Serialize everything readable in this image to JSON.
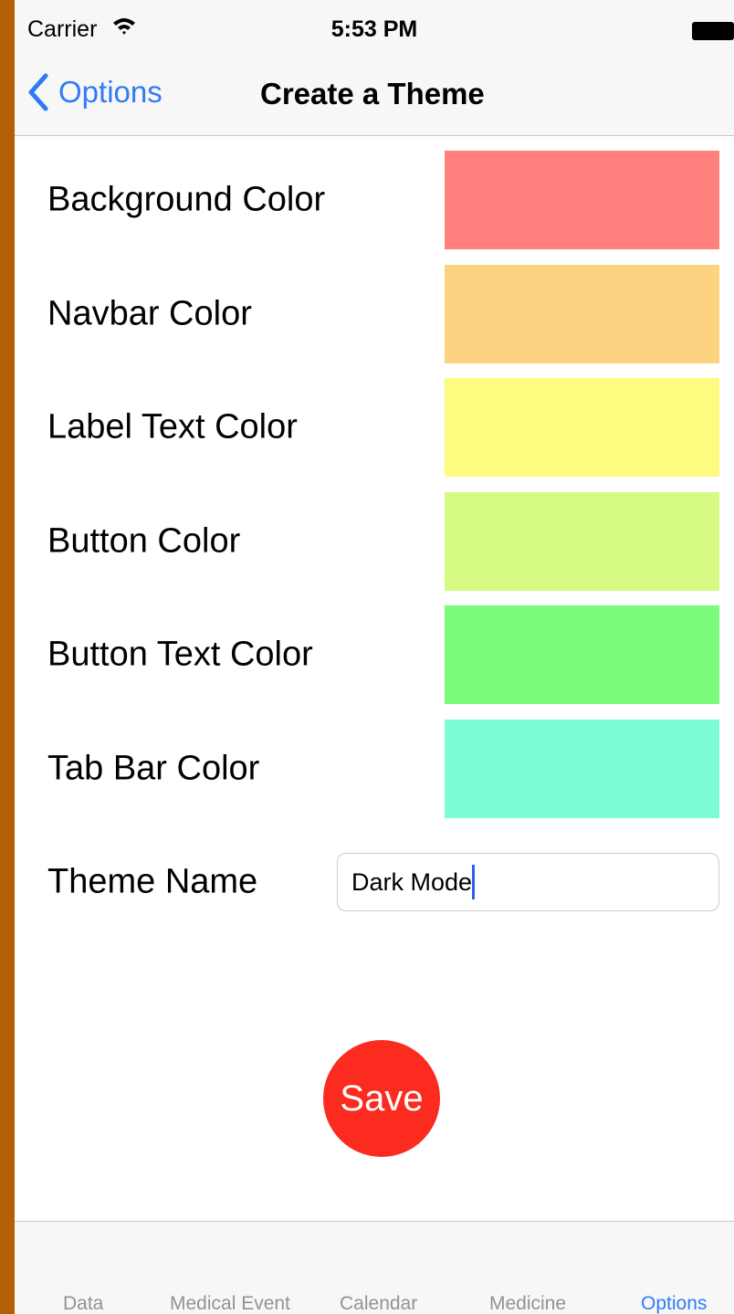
{
  "status_bar": {
    "carrier": "Carrier",
    "time": "5:53 PM"
  },
  "nav": {
    "back_label": "Options",
    "title": "Create a Theme"
  },
  "color_rows": [
    {
      "label": "Background Color",
      "color": "#ff807d"
    },
    {
      "label": "Navbar Color",
      "color": "#fcd381"
    },
    {
      "label": "Label Text Color",
      "color": "#fefb81"
    },
    {
      "label": "Button Color",
      "color": "#d6fa81"
    },
    {
      "label": "Button Text Color",
      "color": "#7cfa7b"
    },
    {
      "label": "Tab Bar Color",
      "color": "#7dfad6"
    }
  ],
  "theme_name": {
    "label": "Theme Name",
    "value": "Dark Mode"
  },
  "save_button": {
    "label": "Save",
    "color": "#fb2c1f"
  },
  "tab_bar": {
    "items": [
      {
        "label": "Data",
        "active": false
      },
      {
        "label": "Medical Event",
        "active": false
      },
      {
        "label": "Calendar",
        "active": false
      },
      {
        "label": "Medicine",
        "active": false
      },
      {
        "label": "Options",
        "active": true
      }
    ]
  },
  "colors": {
    "accent": "#2f7bf6",
    "frame": "#b35f08"
  }
}
